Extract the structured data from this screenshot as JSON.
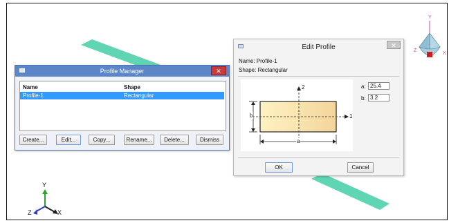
{
  "viewport": {
    "triad_axes": {
      "y": "Y",
      "x": "X",
      "z": "Z"
    },
    "view_cube": {
      "top": "Y",
      "left": "Z",
      "right": "X"
    },
    "colors": {
      "beam": "#5fd5b3",
      "axis_y": "#2aa52a",
      "axis_x": "#202020",
      "axis_z": "#2a3fcc",
      "cube_face": "#9ec9d9"
    }
  },
  "profile_manager": {
    "title": "Profile Manager",
    "columns": [
      "Name",
      "Shape"
    ],
    "rows": [
      {
        "name": "Profile-1",
        "shape": "Rectangular",
        "selected": true
      }
    ],
    "buttons": {
      "create": "Create...",
      "edit": "Edit...",
      "copy": "Copy...",
      "rename": "Rename...",
      "delete": "Delete...",
      "dismiss": "Dismiss"
    }
  },
  "edit_profile": {
    "title": "Edit Profile",
    "name_label": "Name:",
    "name_value": "Profile-1",
    "shape_label": "Shape:",
    "shape_value": "Rectangular",
    "diagram_labels": {
      "axis_1": "1",
      "axis_2": "2",
      "width": "a",
      "height": "b"
    },
    "fields": [
      {
        "label": "a:",
        "value": "25.4"
      },
      {
        "label": "b:",
        "value": "3.2"
      }
    ],
    "ok_label": "OK",
    "cancel_label": "Cancel"
  }
}
